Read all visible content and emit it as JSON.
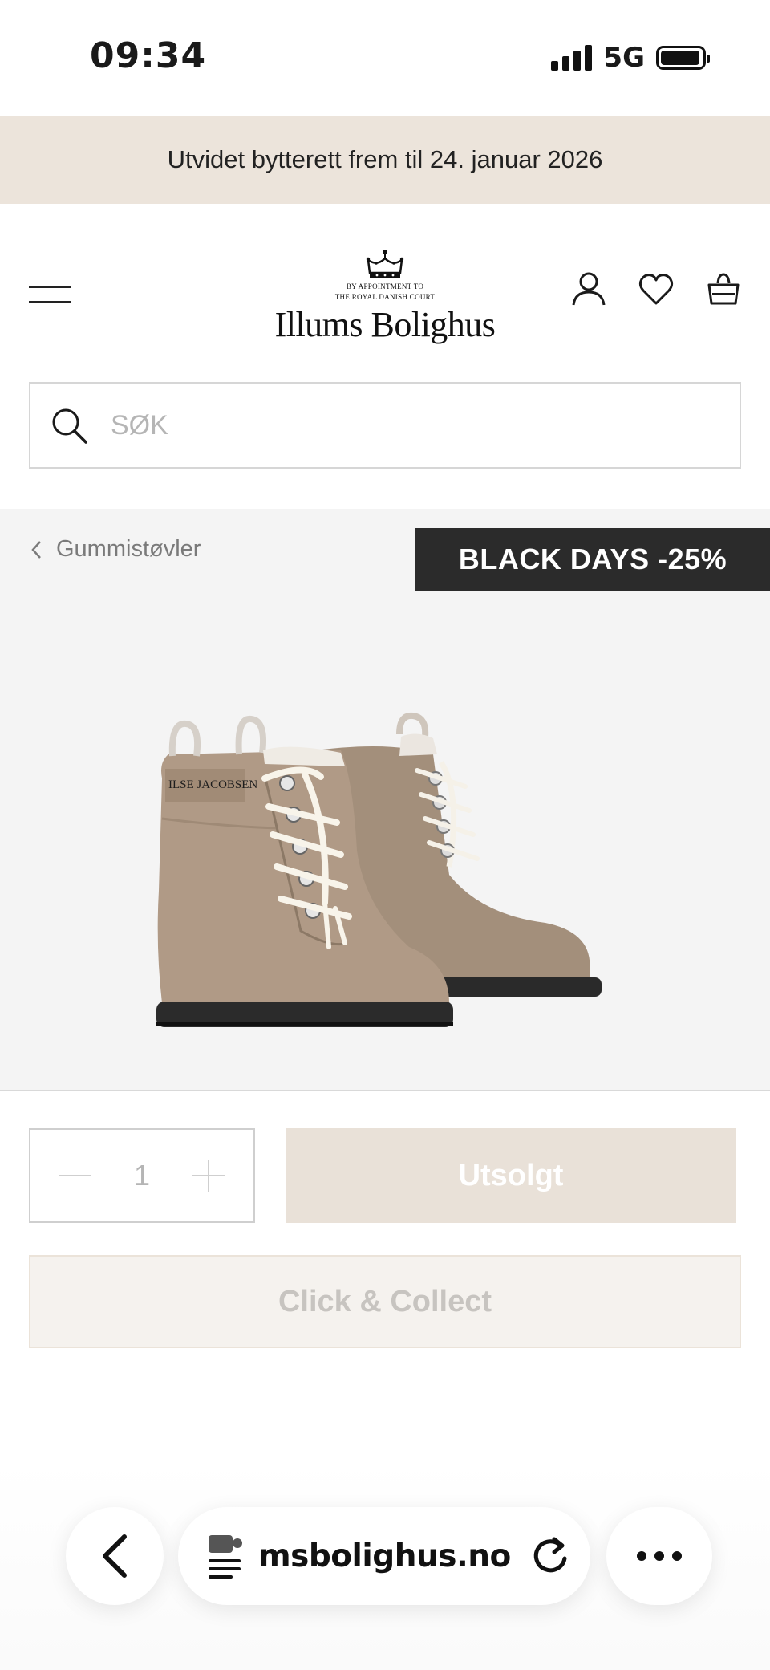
{
  "status_bar": {
    "time": "09:34",
    "network": "5G",
    "battery_level": 0.95
  },
  "promo": {
    "text": "Utvidet bytterett frem til 24. januar 2026"
  },
  "header": {
    "appointment_line1": "BY APPOINTMENT TO",
    "appointment_line2": "THE ROYAL DANISH COURT",
    "brand": "Illums Bolighus",
    "icons": [
      "menu-icon",
      "account-icon",
      "heart-icon",
      "basket-icon"
    ]
  },
  "search": {
    "placeholder": "SØK",
    "value": ""
  },
  "product": {
    "breadcrumb": "Gummistøvler",
    "badge": "BLACK DAYS -25%",
    "boot_brand_text": "ILSE JACOBSEN"
  },
  "actions": {
    "quantity": "1",
    "primary_label": "Utsolgt",
    "secondary_label": "Click & Collect"
  },
  "browser": {
    "url": "msbolighus.no"
  },
  "colors": {
    "promo_bg": "#ece4db",
    "badge_bg": "#2b2b2b",
    "soldout_bg": "#e9e1d8",
    "boot": "#b09a86"
  }
}
